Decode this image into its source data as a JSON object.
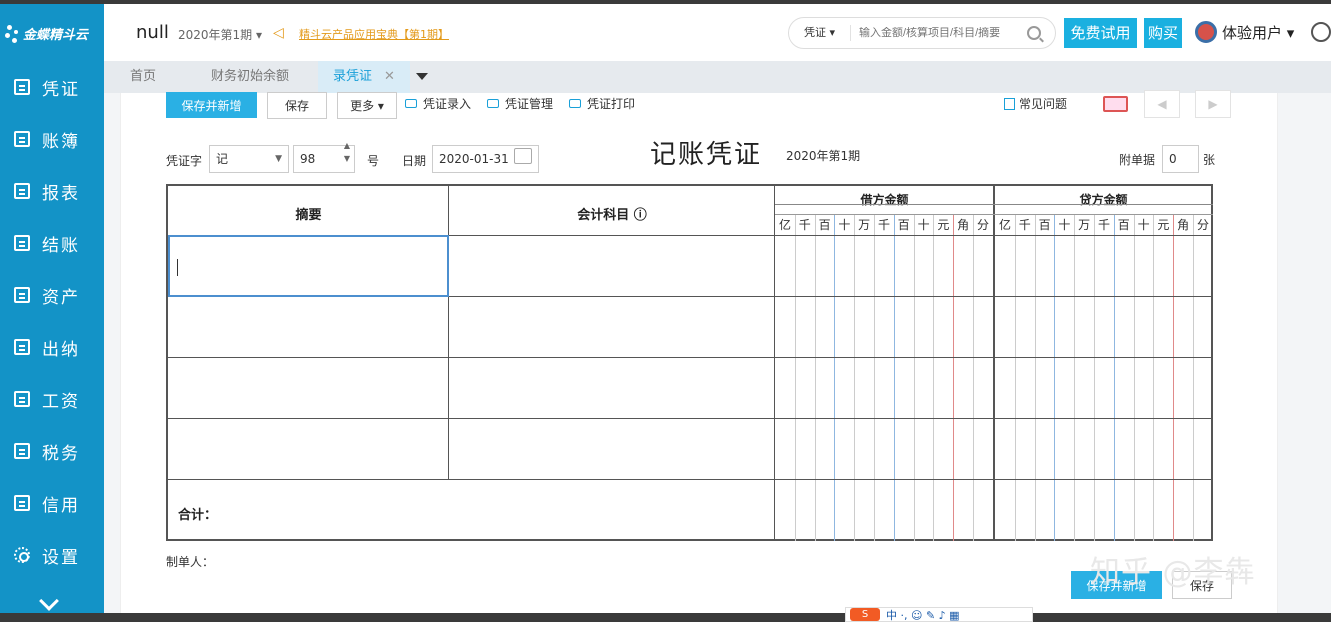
{
  "sidebar": {
    "logo": "金蝶精斗云",
    "items": [
      {
        "label": "凭证",
        "icon": "edit-icon"
      },
      {
        "label": "账簿",
        "icon": "book-icon"
      },
      {
        "label": "报表",
        "icon": "report-icon"
      },
      {
        "label": "结账",
        "icon": "checkout-icon"
      },
      {
        "label": "资产",
        "icon": "asset-icon"
      },
      {
        "label": "出纳",
        "icon": "cashier-icon"
      },
      {
        "label": "工资",
        "icon": "salary-icon"
      },
      {
        "label": "税务",
        "icon": "tax-icon"
      },
      {
        "label": "信用",
        "icon": "credit-icon"
      },
      {
        "label": "设置",
        "icon": "gear-icon"
      }
    ]
  },
  "header": {
    "title": "null",
    "period": "2020年第1期 ▾",
    "notice_link": "精斗云产品应用宝典【第1期】",
    "search": {
      "type": "凭证 ▾",
      "placeholder": "输入金额/核算项目/科目/摘要"
    },
    "trial_button": "免费试用",
    "buy_button": "购买",
    "user": "体验用户 ▾"
  },
  "tabs": [
    {
      "label": "首页"
    },
    {
      "label": "财务初始余额"
    },
    {
      "label": "录凭证",
      "close": "✕"
    }
  ],
  "toolbar": {
    "save_new": "保存并新增",
    "save": "保存",
    "more": "更多 ▾",
    "entry": "凭证录入",
    "manage": "凭证管理",
    "print": "凭证打印",
    "faq": "常见问题",
    "prev": "◀",
    "next": "▶"
  },
  "voucher": {
    "word_label": "凭证字",
    "word_value": "记",
    "number_value": "98",
    "number_suffix": "号",
    "date_label": "日期",
    "date_value": "2020-01-31",
    "title": "记账凭证",
    "period": "2020年第1期",
    "attach_label": "附单据",
    "attach_value": "0",
    "attach_unit": "张",
    "col_summary": "摘要",
    "col_account": "会计科目 ⓘ",
    "col_debit": "借方金额",
    "col_credit": "贷方金额",
    "digits": [
      "亿",
      "千",
      "百",
      "十",
      "万",
      "千",
      "百",
      "十",
      "元",
      "角",
      "分"
    ],
    "total_label": "合计：",
    "maker_label": "制单人："
  },
  "footer": {
    "save_new": "保存并新增",
    "save": "保存"
  },
  "watermark": "知乎 @李犇",
  "ime": {
    "logo": "S",
    "items": "中 ·, ☺ ✎ ♪ ▦"
  },
  "colors": {
    "sidebar": "#1393c7",
    "accent": "#1ab0e0",
    "link": "#e39a1b"
  }
}
